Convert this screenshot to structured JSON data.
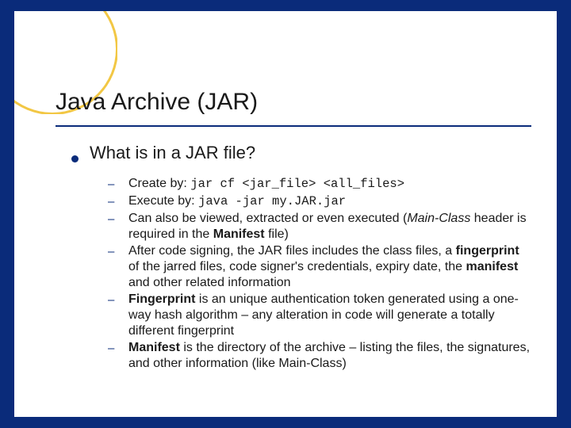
{
  "title": "Java Archive (JAR)",
  "question": "What is in a JAR file?",
  "items": [
    {
      "pre": "Create by: ",
      "code": "jar cf <jar_file> <all_files>",
      "post": ""
    },
    {
      "pre": "Execute by: ",
      "code": "java -jar my.JAR.jar",
      "post": ""
    },
    {
      "html": "Can also be viewed, extracted or even executed (<i>Main-Class</i> header is required in the <b>Manifest</b> file)"
    },
    {
      "html": "After code signing, the JAR files includes the class files, a <b>fingerprint</b> of the jarred files, code signer's credentials, expiry date, the <b>manifest</b> and other related information"
    },
    {
      "html": "<b>Fingerprint</b> is an unique authentication token generated using a one-way hash algorithm – any alteration in code will generate a totally different fingerprint"
    },
    {
      "html": "<b>Manifest</b> is the directory of the archive – listing the files, the signatures, and other information (like Main-Class)"
    }
  ]
}
